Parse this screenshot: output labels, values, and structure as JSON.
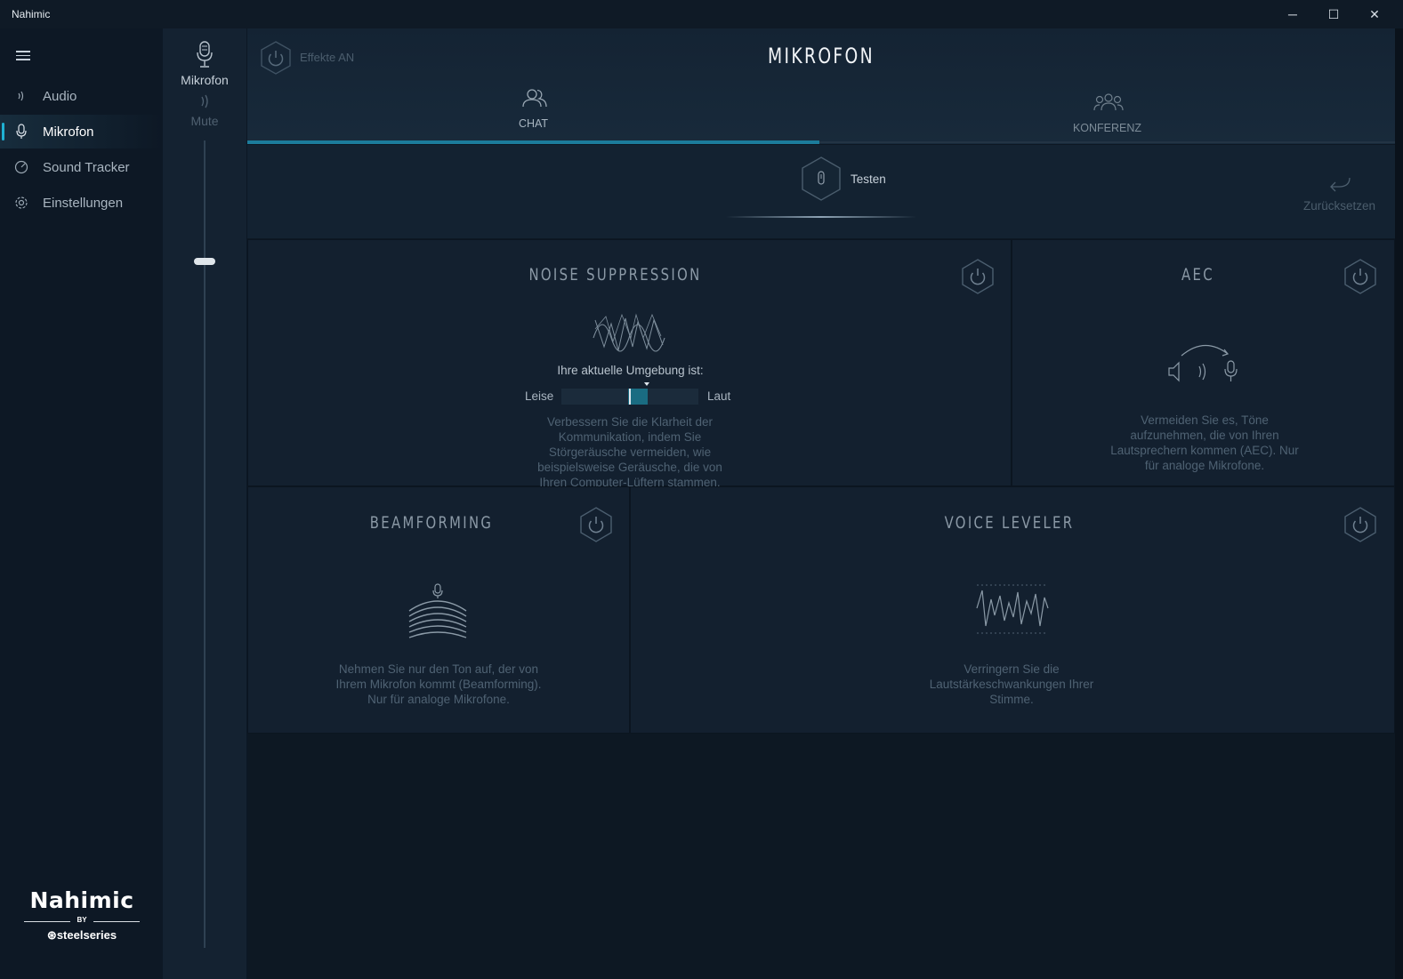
{
  "window": {
    "title": "Nahimic",
    "minimize": "─",
    "maximize": "☐",
    "close": "✕"
  },
  "sidebar": {
    "items": [
      {
        "label": "Audio",
        "icon": "speaker-waves-icon"
      },
      {
        "label": "Mikrofon",
        "icon": "microphone-icon",
        "active": true
      },
      {
        "label": "Sound Tracker",
        "icon": "radar-icon"
      },
      {
        "label": "Einstellungen",
        "icon": "gear-icon"
      }
    ],
    "brand": {
      "name": "Nahimic",
      "by": "BY",
      "partner": "steelseries"
    }
  },
  "volume": {
    "device_label": "Mikrofon",
    "mute_label": "Mute",
    "level": 0.85
  },
  "header": {
    "effects_label": "Effekte AN",
    "title": "MIKROFON",
    "tabs": [
      {
        "label": "CHAT",
        "active": true
      },
      {
        "label": "KONFERENZ",
        "active": false
      }
    ]
  },
  "test": {
    "label": "Testen",
    "reset_label": "Zurücksetzen"
  },
  "cards": {
    "noise": {
      "title": "NOISE SUPPRESSION",
      "env_label": "Ihre aktuelle Umgebung ist:",
      "low_label": "Leise",
      "high_label": "Laut",
      "env_level": 0.55,
      "description": "Verbessern Sie die Klarheit der Kommunikation, indem Sie Störgeräusche vermeiden, wie beispielsweise Geräusche, die von Ihren Computer-Lüftern stammen."
    },
    "aec": {
      "title": "AEC",
      "description": "Vermeiden Sie es, Töne aufzunehmen, die von Ihren Lautsprechern kommen (AEC). Nur für analoge Mikrofone."
    },
    "beam": {
      "title": "BEAMFORMING",
      "description": "Nehmen Sie nur den Ton auf, der von Ihrem Mikrofon kommt (Beamforming). Nur für analoge Mikrofone."
    },
    "voice": {
      "title": "VOICE LEVELER",
      "description": "Verringern Sie die Lautstärkeschwankungen Ihrer Stimme."
    }
  },
  "colors": {
    "accent": "#1fb1d3",
    "background": "#0c1724",
    "card": "#13202f"
  }
}
